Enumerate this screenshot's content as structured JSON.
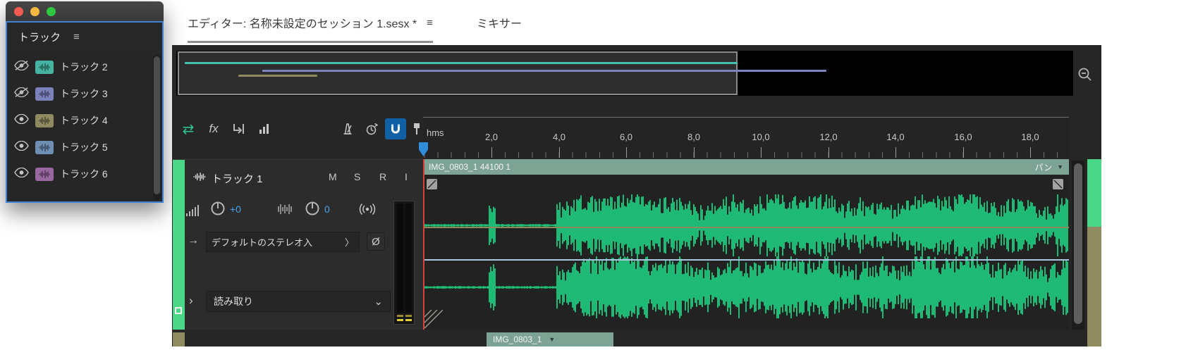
{
  "tracks_panel": {
    "title": "トラック",
    "tracks": [
      {
        "name": "トラック 2",
        "visible": false,
        "color": "#45b3a2"
      },
      {
        "name": "トラック 3",
        "visible": false,
        "color": "#7b81ba"
      },
      {
        "name": "トラック 4",
        "visible": true,
        "color": "#8f8a5f"
      },
      {
        "name": "トラック 5",
        "visible": true,
        "color": "#6d8fb3"
      },
      {
        "name": "トラック 6",
        "visible": true,
        "color": "#9a68a0"
      }
    ]
  },
  "tabs": {
    "editor": "エディター: 名称未設定のセッション 1.sesx *",
    "mixer": "ミキサー"
  },
  "ruler": {
    "unit": "hms",
    "ticks": [
      "2,0",
      "4,0",
      "6,0",
      "8,0",
      "10,0",
      "12,0",
      "14,0",
      "16,0",
      "18,0"
    ]
  },
  "track1": {
    "name": "トラック 1",
    "mute": "M",
    "solo": "S",
    "record": "R",
    "input_monitor": "I",
    "volume": "+0",
    "pan": "0",
    "input": "デフォルトのステレオ入",
    "automation_mode": "読み取り"
  },
  "clip": {
    "title": "IMG_0803_1 44100 1",
    "envelope_label": "パン"
  },
  "clip2": {
    "title": "IMG_0803_1"
  },
  "icons": {
    "menu": "≡",
    "triangle_down": "▼",
    "chevron_right": "〉",
    "chevron_down": "⌄",
    "arrow_right": "→",
    "expander": "›",
    "phase": "Ø",
    "move_tool": "⇄",
    "fx": "fx"
  },
  "colors": {
    "track1_strip": "#4cd687",
    "waveform": "#1fe08c",
    "clip_header": "#7ca394",
    "volume_envelope": "#8f8a5a",
    "pan_envelope": "#a9c7e2",
    "playhead_line": "#d8413a",
    "playhead_handle": "#2f8fdd",
    "focus_border": "#3f83d6"
  }
}
